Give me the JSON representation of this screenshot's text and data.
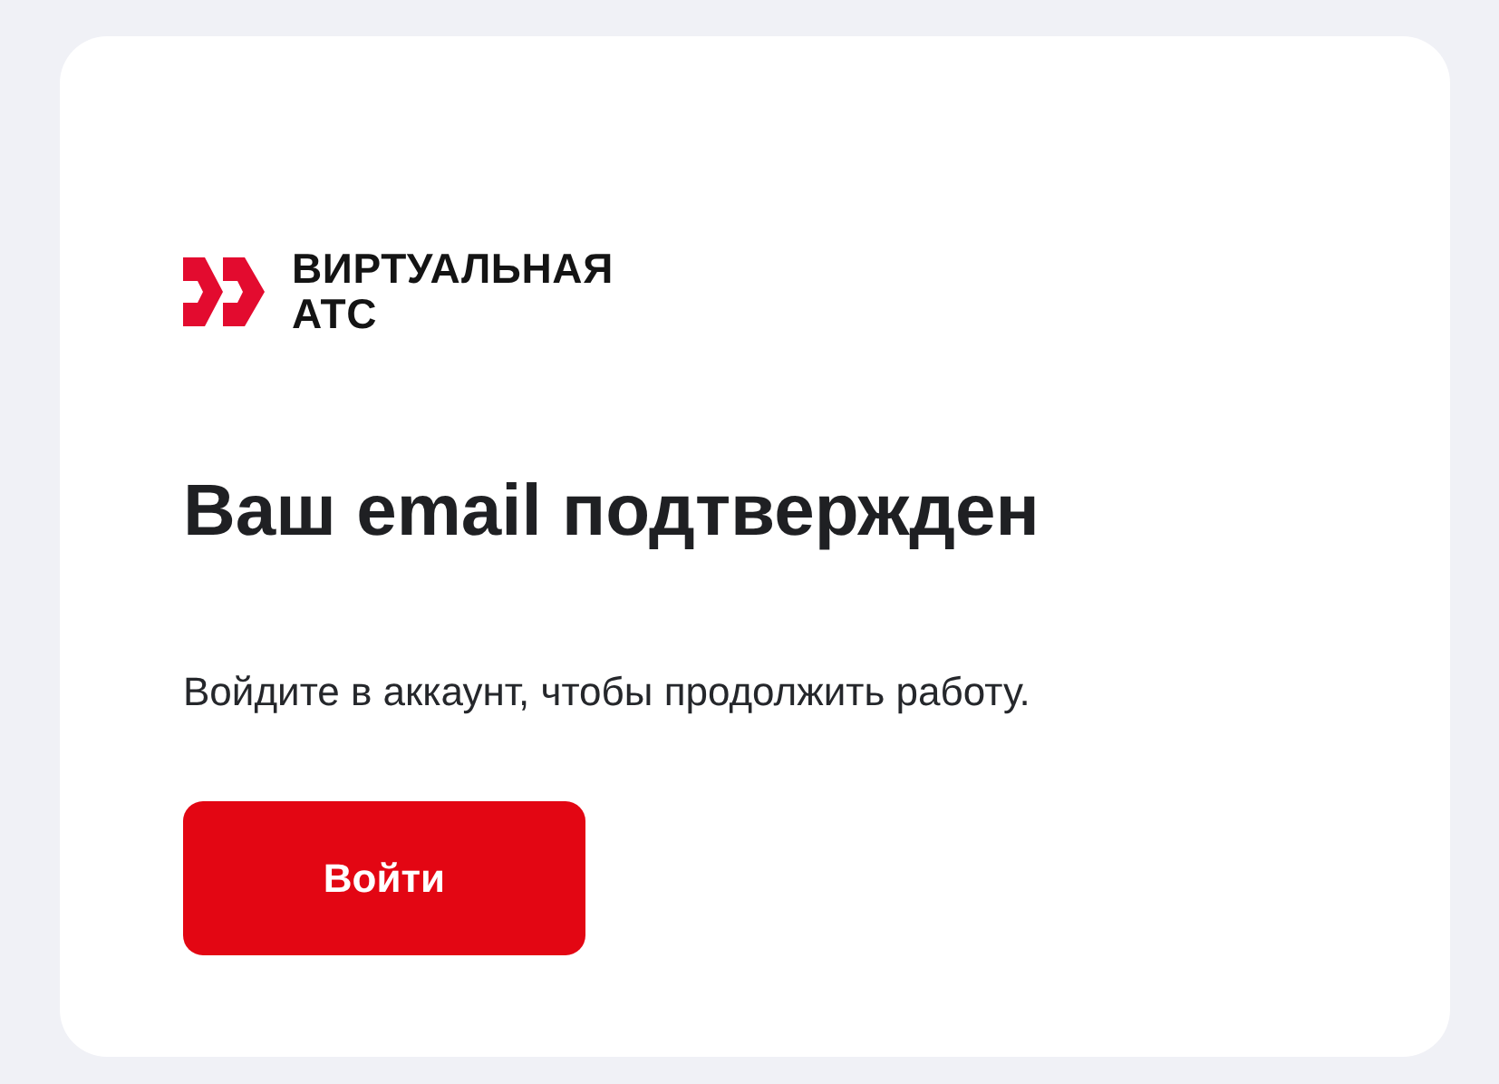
{
  "logo": {
    "lines": [
      "ВИРТУАЛЬНАЯ",
      "АТС"
    ]
  },
  "title": "Ваш email подтвержден",
  "message": "Войдите в аккаунт, чтобы продолжить работу.",
  "button": {
    "label": "Войти"
  }
}
